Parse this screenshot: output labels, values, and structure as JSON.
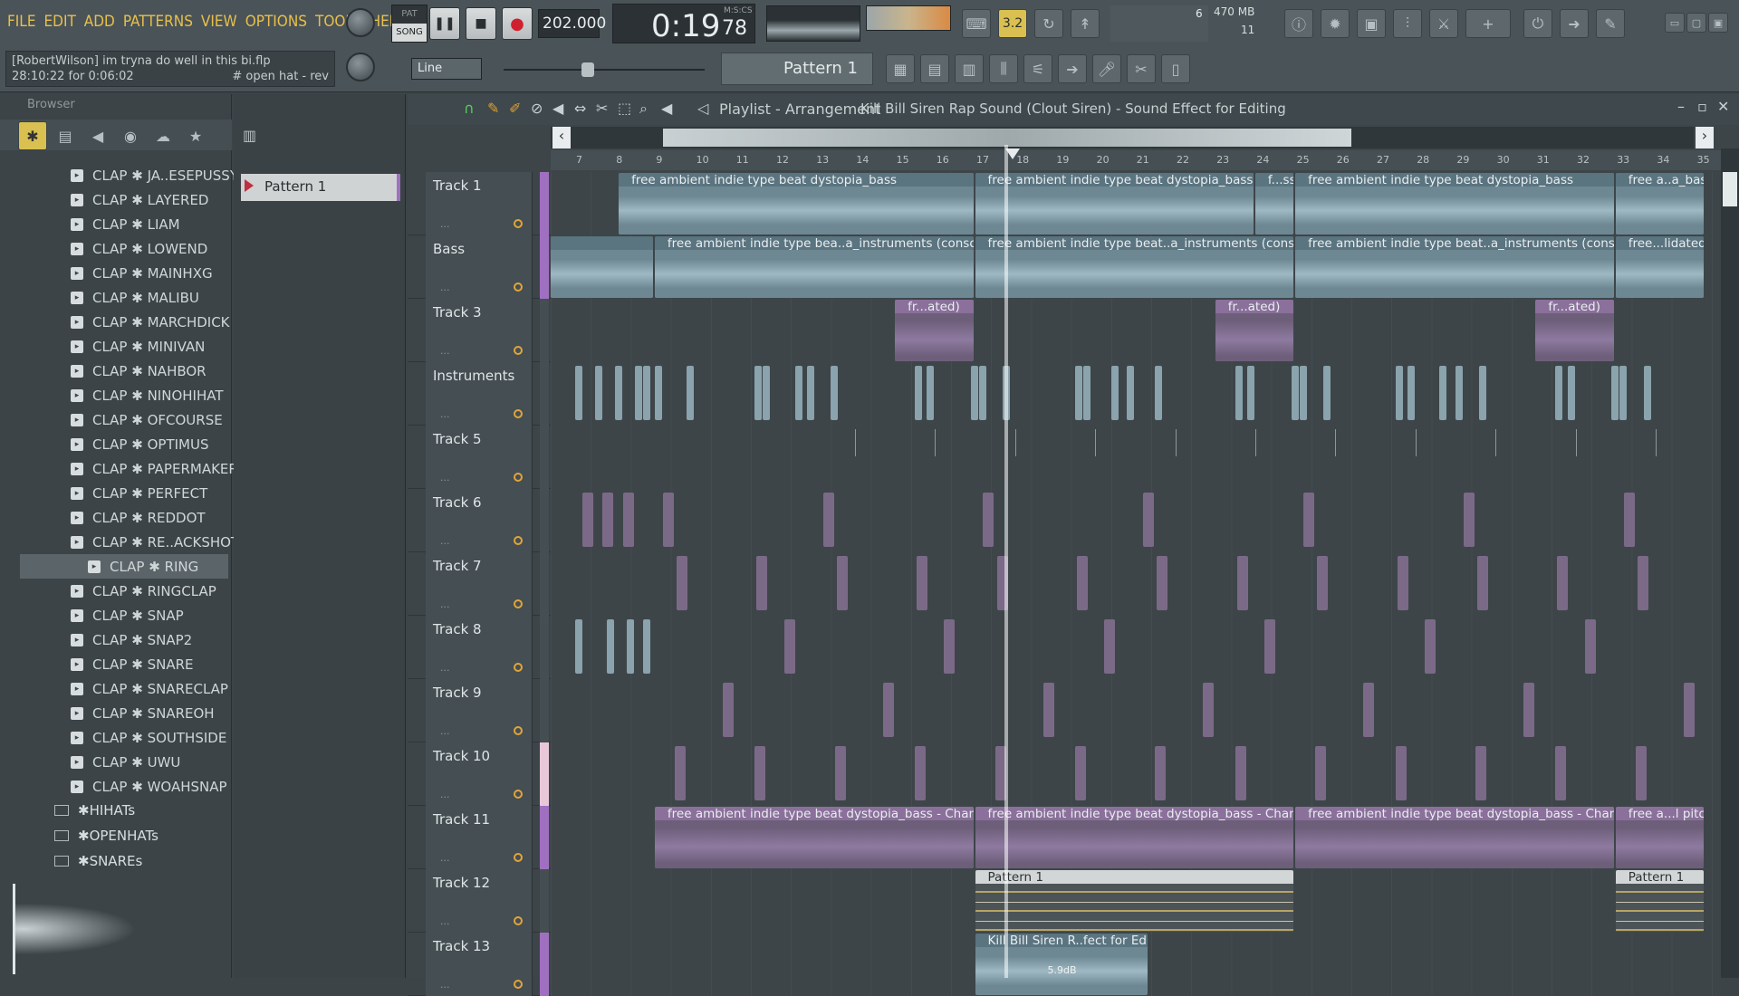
{
  "menu": [
    "FILE",
    "EDIT",
    "ADD",
    "PATTERNS",
    "VIEW",
    "OPTIONS",
    "TOOLS",
    "HELP"
  ],
  "transport": {
    "pat_label": "PAT",
    "song_label": "SONG",
    "tempo": "202.000",
    "time": "0:19",
    "time_sub": "78",
    "time_unit": "M:S:CS",
    "cpu_count": "6",
    "ram": "470 MB",
    "poly": "11",
    "snap": "Line",
    "pattern": "Pattern 1"
  },
  "hint": {
    "line1": "[RobertWilson] im tryna do well in this bi.flp",
    "line2": "28:10:22 for 0:06:02",
    "line2b": "# open hat - rev"
  },
  "browser": {
    "title": "Browser",
    "items": [
      "CLAP ✱ JA..ESEPUSSY",
      "CLAP ✱ LAYERED",
      "CLAP ✱ LIAM",
      "CLAP ✱ LOWEND",
      "CLAP ✱ MAINHXG",
      "CLAP ✱ MALIBU",
      "CLAP ✱ MARCHDICK",
      "CLAP ✱ MINIVAN",
      "CLAP ✱ NAHBOR",
      "CLAP ✱ NINOHIHAT",
      "CLAP ✱ OFCOURSE",
      "CLAP ✱ OPTIMUS",
      "CLAP ✱ PAPERMAKER",
      "CLAP ✱ PERFECT",
      "CLAP ✱ REDDOT",
      "CLAP ✱ RE..ACKSHOTS",
      "CLAP ✱ RING",
      "CLAP ✱ RINGCLAP",
      "CLAP ✱ SNAP",
      "CLAP ✱ SNAP2",
      "CLAP ✱ SNARE",
      "CLAP ✱ SNARECLAP",
      "CLAP ✱ SNAREOH",
      "CLAP ✱ SOUTHSIDE",
      "CLAP ✱ UWU",
      "CLAP ✱ WOAHSNAP"
    ],
    "selected_index": 16,
    "folders": [
      "✱HIHATs",
      "✱OPENHATs",
      "✱SNAREs"
    ]
  },
  "picker": {
    "pattern": "Pattern 1"
  },
  "playlist": {
    "title": "Playlist - Arrangement",
    "subtitle": "Kill Bill Siren Rap Sound (Clout Siren) - Sound Effect for Editing",
    "bars": [
      "7",
      "8",
      "9",
      "10",
      "11",
      "12",
      "13",
      "14",
      "15",
      "16",
      "17",
      "18",
      "19",
      "20",
      "21",
      "22",
      "23",
      "24",
      "25",
      "26",
      "27",
      "28",
      "29",
      "30",
      "31",
      "32",
      "33",
      "34",
      "35"
    ],
    "tracks": [
      "Track 1",
      "Bass",
      "Track 3",
      "Instruments",
      "Track 5",
      "Track 6",
      "Track 7",
      "Track 8",
      "Track 9",
      "Track 10",
      "Track 11",
      "Track 12",
      "Track 13"
    ],
    "clips": {
      "t1": "free ambient indie type beat dystopia_bass",
      "t1s": "f...ss",
      "t1e": "free a..a_bass",
      "t2": "free ambient indie type bea..a_instruments (consolidated)",
      "t2b": "free ambient indie type beat..a_instruments (consolidated)",
      "t2e": "free...lidated)",
      "t3": "fr...ated)",
      "t11": "free ambient indie type beat dystopia_bass - Channel pitch",
      "t11e": "free a...l pitch",
      "t12": "Pattern 1",
      "t13": "Kill Bill Siren R..fect for Editing",
      "t13db": "5.9dB"
    }
  },
  "colors": {
    "accent": "#e8c04a",
    "clip_blue": "#6c8590",
    "clip_purple": "#7d6c88"
  }
}
